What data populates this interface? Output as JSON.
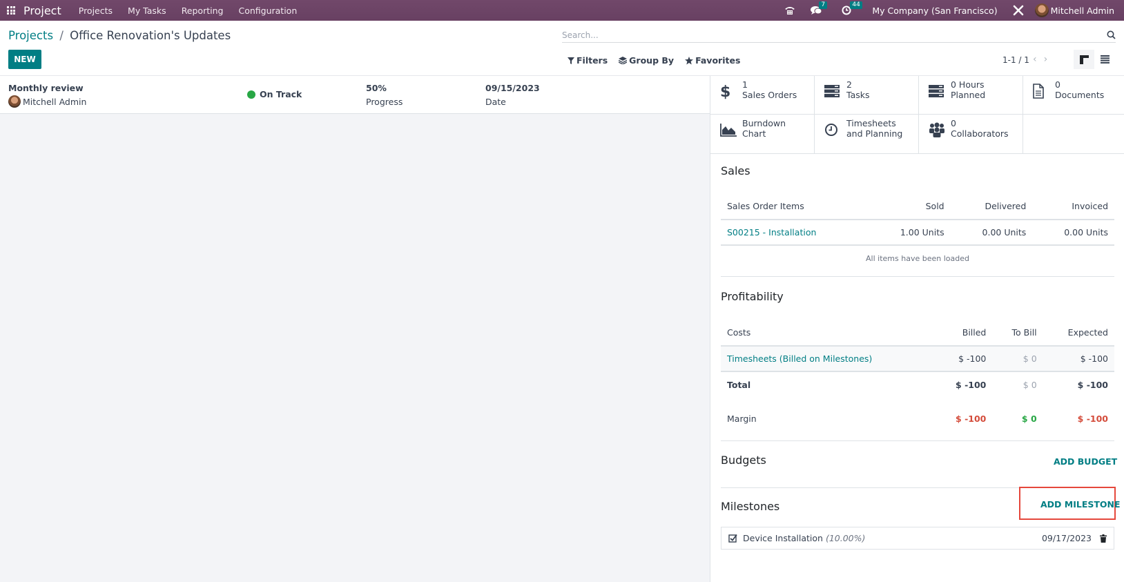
{
  "navbar": {
    "app_name": "Project",
    "menu": [
      "Projects",
      "My Tasks",
      "Reporting",
      "Configuration"
    ],
    "messages_badge": "7",
    "activities_badge": "44",
    "company": "My Company (San Francisco)",
    "user": "Mitchell Admin",
    "brand_color": "#714B67"
  },
  "control_panel": {
    "breadcrumb_parent": "Projects",
    "breadcrumb_separator": "/",
    "breadcrumb_current": "Office Renovation's Updates",
    "new_label": "NEW",
    "search_placeholder": "Search...",
    "filters_label": "Filters",
    "group_by_label": "Group By",
    "favorites_label": "Favorites",
    "pager": "1-1 / 1",
    "accent_color": "#017E84"
  },
  "updates": [
    {
      "title": "Monthly review",
      "user": "Mitchell Admin",
      "status": "On Track",
      "status_color": "#28A745",
      "progress_value": "50%",
      "progress_label": "Progress",
      "date_value": "09/15/2023",
      "date_label": "Date"
    }
  ],
  "stats": [
    {
      "icon": "dollar-icon",
      "value": "1",
      "label": "Sales Orders"
    },
    {
      "icon": "tasks-icon",
      "value": "2",
      "label": "Tasks"
    },
    {
      "icon": "tasks-icon",
      "value": "0 Hours",
      "label": "Planned"
    },
    {
      "icon": "document-icon",
      "value": "0",
      "label": "Documents"
    },
    {
      "icon": "area-chart-icon",
      "value": "Burndown",
      "label": "Chart"
    },
    {
      "icon": "clock-icon",
      "value": "Timesheets",
      "label": "and Planning"
    },
    {
      "icon": "users-icon",
      "value": "0",
      "label": "Collaborators"
    }
  ],
  "sales": {
    "title": "Sales",
    "headers": [
      "Sales Order Items",
      "Sold",
      "Delivered",
      "Invoiced"
    ],
    "rows": [
      [
        "S00215 - Installation",
        "1.00 Units",
        "0.00 Units",
        "0.00 Units"
      ]
    ],
    "footer": "All items have been loaded"
  },
  "profitability": {
    "title": "Profitability",
    "headers": [
      "Costs",
      "Billed",
      "To Bill",
      "Expected"
    ],
    "rows": [
      [
        "Timesheets (Billed on Milestones)",
        "$ -100",
        "$ 0",
        "$ -100"
      ]
    ],
    "total": [
      "Total",
      "$ -100",
      "$ 0",
      "$ -100"
    ],
    "margin": [
      "Margin",
      "$ -100",
      "$ 0",
      "$ -100"
    ]
  },
  "budgets": {
    "title": "Budgets",
    "action": "ADD BUDGET"
  },
  "milestones": {
    "title": "Milestones",
    "action": "ADD MILESTONE",
    "items": [
      {
        "name": "Device Installation",
        "percent": "(10.00%)",
        "date": "09/17/2023",
        "done": true
      }
    ]
  }
}
